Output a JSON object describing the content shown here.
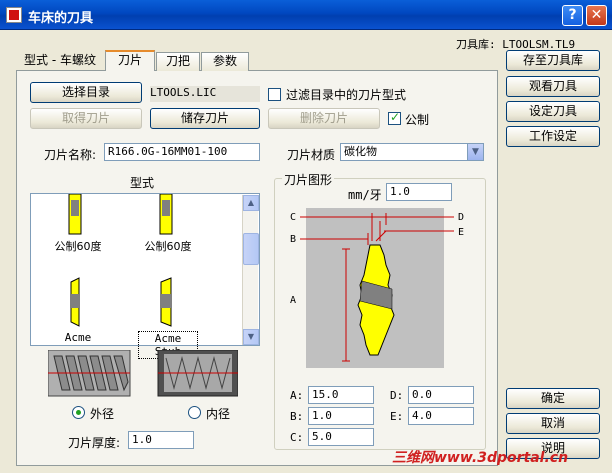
{
  "window": {
    "title": "车床的刀具",
    "help_label": "?",
    "close_label": "✕"
  },
  "library": {
    "label": "刀具库: LTOOLSM.TL9"
  },
  "tabs": [
    {
      "label": "型式 - 车螺纹"
    },
    {
      "label": "刀片"
    },
    {
      "label": "刀把"
    },
    {
      "label": "参数"
    }
  ],
  "toolbar": {
    "select_dir": "选择目录",
    "get_insert": "取得刀片",
    "save_insert": "储存刀片",
    "delete_insert": "删除刀片",
    "dir_value": "LTOOLS.LIC",
    "filter_label": "过滤目录中的刀片型式",
    "metric_label": "公制"
  },
  "insert": {
    "name_label": "刀片名称:",
    "name_value": "R166.0G-16MM01-100",
    "material_label": "刀片材质",
    "material_value": "碳化物"
  },
  "styles": {
    "title": "型式",
    "items": [
      "公制60度",
      "公制60度",
      "Acme",
      "Acme Stub"
    ]
  },
  "diameter": {
    "outer": "外径",
    "inner": "内径"
  },
  "thickness": {
    "label": "刀片厚度:",
    "value": "1.0"
  },
  "graphic": {
    "title": "刀片图形",
    "pitch_label": "mm/牙",
    "pitch_value": "1.0",
    "letters": {
      "a": "A",
      "b": "B",
      "c": "C",
      "d": "D",
      "e": "E"
    },
    "params": {
      "a_label": "A:",
      "a_value": "15.0",
      "b_label": "B:",
      "b_value": "1.0",
      "c_label": "C:",
      "c_value": "5.0",
      "d_label": "D:",
      "d_value": "0.0",
      "e_label": "E:",
      "e_value": "4.0"
    }
  },
  "side": {
    "save_to_lib": "存至刀具库",
    "view_tool": "观看刀具",
    "set_tool": "设定刀具",
    "work_settings": "工作设定",
    "ok": "确定",
    "cancel": "取消",
    "help": "说明"
  },
  "watermark": "三维网www.3dportal.cn",
  "colors": {
    "insert": "#ffff00",
    "drawing_bg": "#c0c0c0",
    "dimension": "#cc0000"
  }
}
